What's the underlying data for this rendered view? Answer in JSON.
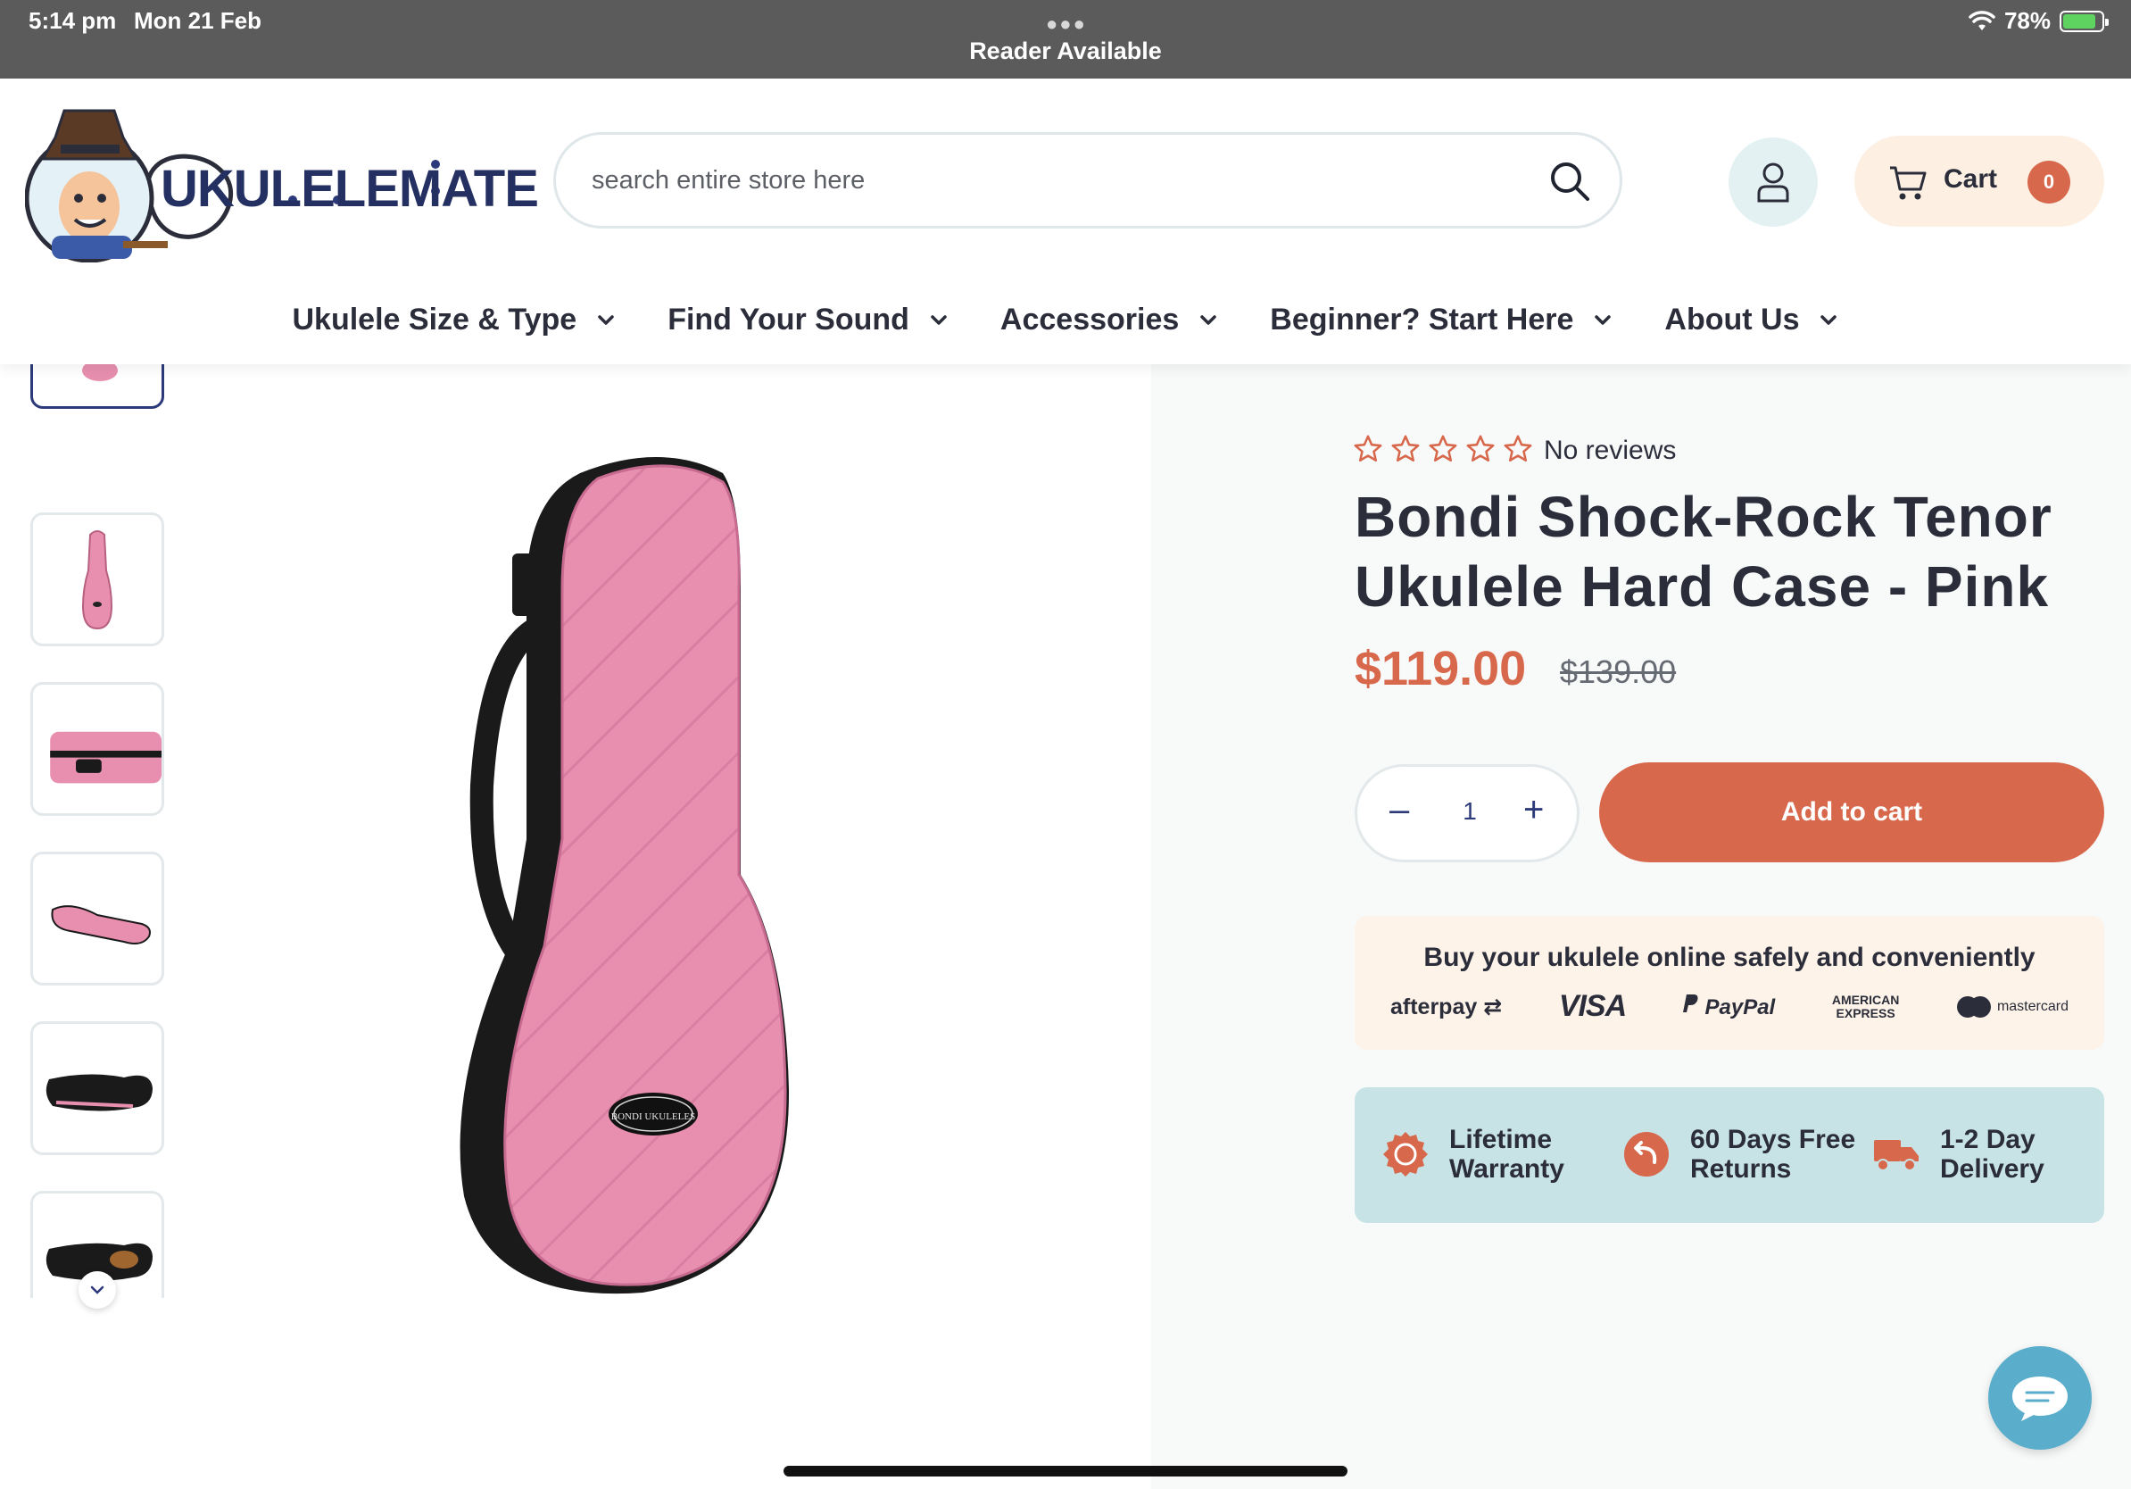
{
  "status_bar": {
    "time": "5:14 pm",
    "date": "Mon 21 Feb",
    "reader": "Reader Available",
    "battery": "78%",
    "battery_level": 0.78
  },
  "header": {
    "logo_text": "UKULELEMATE",
    "search_placeholder": "search entire store here",
    "cart_label": "Cart",
    "cart_count": "0"
  },
  "nav": {
    "items": [
      {
        "label": "Ukulele Size & Type"
      },
      {
        "label": "Find Your Sound"
      },
      {
        "label": "Accessories"
      },
      {
        "label": "Beginner? Start Here"
      },
      {
        "label": "About Us"
      }
    ]
  },
  "product": {
    "reviews": "No reviews",
    "rating_stars": 0,
    "title": "Bondi Shock-Rock Tenor Ukulele Hard Case - Pink",
    "price": "$119.00",
    "compare_price": "$139.00",
    "quantity": "1",
    "add_to_cart": "Add to cart",
    "badge_text": "BONDI UKULELES"
  },
  "payments": {
    "heading": "Buy your ukulele online safely and conveniently",
    "methods": {
      "afterpay": "afterpay",
      "visa": "VISA",
      "paypal": "PayPal",
      "amex_line1": "AMERICAN",
      "amex_line2": "EXPRESS",
      "mastercard": "mastercard"
    }
  },
  "trust": {
    "warranty": "Lifetime Warranty",
    "returns": "60 Days Free Returns",
    "delivery": "1-2 Day Delivery"
  },
  "colors": {
    "accent": "#d8684c",
    "navy": "#2c3a7a",
    "case_pink": "#e88fb0",
    "trust_bg": "#c7e3e6",
    "pay_bg": "#fdf3e8"
  },
  "icons": [
    "wifi-icon",
    "battery-icon",
    "search-icon",
    "user-icon",
    "cart-icon",
    "chevron-down-icon",
    "star-icon",
    "badge-icon",
    "return-icon",
    "truck-icon",
    "chat-icon"
  ]
}
